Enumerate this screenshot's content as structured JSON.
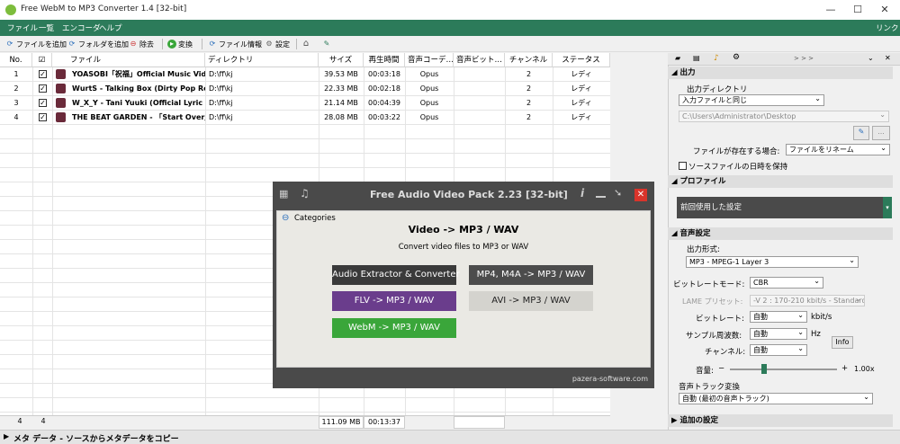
{
  "window": {
    "title": "Free WebM to MP3 Converter 1.4  [32-bit]",
    "minimize": "—",
    "maximize": "☐",
    "close": "✕"
  },
  "menu": {
    "items": [
      "ファイル",
      "一覧",
      "エンコーダ",
      "ヘルプ"
    ],
    "link": "リンク"
  },
  "toolbar": {
    "add_file": "ファイルを追加",
    "add_folder": "フォルダを追加",
    "remove": "除去",
    "convert": "変換",
    "file_info": "ファイル情報",
    "settings": "設定"
  },
  "table": {
    "headers": [
      "No.",
      "☑",
      "ファイル",
      "ディレクトリ",
      "サイズ",
      "再生時間",
      "音声コーデ…",
      "音声ビット…",
      "チャンネル",
      "ステータス"
    ],
    "rows": [
      {
        "no": "1",
        "file": "YOASOBI「祝福」Official Music Vide…",
        "dir": "D:\\ff\\kj",
        "size": "39.53 MB",
        "duration": "00:03:18",
        "codec": "Opus",
        "bitrate": "",
        "channels": "2",
        "status": "レディ"
      },
      {
        "no": "2",
        "file": "WurtS - Talking Box (Dirty Pop Remix) …",
        "dir": "D:\\ff\\kj",
        "size": "22.33 MB",
        "duration": "00:02:18",
        "codec": "Opus",
        "bitrate": "",
        "channels": "2",
        "status": "レディ"
      },
      {
        "no": "3",
        "file": "W_X_Y - Tani Yuuki (Official Lyric Vide…",
        "dir": "D:\\ff\\kj",
        "size": "21.14 MB",
        "duration": "00:04:39",
        "codec": "Opus",
        "bitrate": "",
        "channels": "2",
        "status": "レディ"
      },
      {
        "no": "4",
        "file": "THE BEAT GARDEN - 「Start Over」(O…",
        "dir": "D:\\ff\\kj",
        "size": "28.08 MB",
        "duration": "00:03:22",
        "codec": "Opus",
        "bitrate": "",
        "channels": "2",
        "status": "レディ"
      }
    ],
    "footer": {
      "count": "4",
      "checked": "4",
      "total_size": "111.09 MB",
      "total_duration": "00:13:37"
    }
  },
  "status_bar": {
    "text": "メタ データ - ソースからメタデータをコピー"
  },
  "right_panel": {
    "tabs_more": "> > >",
    "output": {
      "header": "出力",
      "dir_label": "出力ディレクトリ",
      "dir_option": "入力ファイルと同じ",
      "dir_path": "C:\\Users\\Administrator\\Desktop",
      "browse": "...",
      "exists_label": "ファイルが存在する場合:",
      "exists_option": "ファイルをリネーム",
      "keep_date_label": "ソースファイルの日時を保持"
    },
    "profile": {
      "header": "プロファイル",
      "value": "前回使用した設定"
    },
    "audio": {
      "header": "音声設定",
      "format_label": "出力形式:",
      "format_value": "MP3 - MPEG-1 Layer 3",
      "bitrate_mode_label": "ビットレートモード:",
      "bitrate_mode_value": "CBR",
      "lame_label": "LAME プリセット:",
      "lame_value": "-V 2 : 170-210 kbit/s - Standard",
      "bitrate_label": "ビットレート:",
      "bitrate_value": "自動",
      "bitrate_unit": "kbit/s",
      "samplerate_label": "サンプル周波数:",
      "samplerate_value": "自動",
      "samplerate_unit": "Hz",
      "info_button": "Info",
      "channels_label": "チャンネル:",
      "channels_value": "自動",
      "volume_label": "音量:",
      "volume_minus": "−",
      "volume_plus": "+",
      "volume_value": "1.00x",
      "track_label": "音声トラック変換",
      "track_value": "自動 (最初の音声トラック)"
    },
    "advanced": {
      "header": "追加の設定"
    }
  },
  "dialog": {
    "title": "Free Audio Video Pack 2.23 [32-bit]",
    "back": "Categories",
    "heading": "Video -> MP3 / WAV",
    "subtitle": "Convert video files to MP3 or WAV",
    "buttons": [
      {
        "label": "Audio Extractor & Converter",
        "color": "#3a3a3a"
      },
      {
        "label": "MP4, M4A -> MP3 / WAV",
        "color": "#4c4c4c"
      },
      {
        "label": "FLV -> MP3 / WAV",
        "color": "#6a3d8c"
      },
      {
        "label": "AVI -> MP3 / WAV",
        "color": "#d4d3ce"
      },
      {
        "label": "WebM -> MP3 / WAV",
        "color": "#3aa63a"
      }
    ],
    "footer": "pazera-software.com"
  }
}
